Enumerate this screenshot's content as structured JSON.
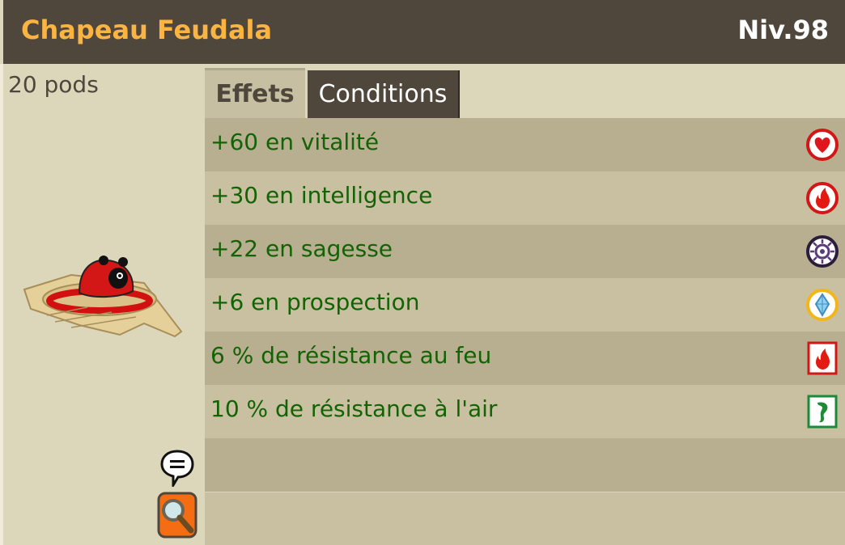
{
  "item": {
    "name": "Chapeau Feudala",
    "level": "Niv.98",
    "weight": "20 pods"
  },
  "tabs": [
    {
      "label": "Effets",
      "active": true
    },
    {
      "label": "Conditions",
      "active": false
    }
  ],
  "effects": [
    {
      "text": "+60 en vitalité",
      "icon": "vitality-heart-icon"
    },
    {
      "text": "+30 en intelligence",
      "icon": "intelligence-fire-icon"
    },
    {
      "text": "+22 en sagesse",
      "icon": "wisdom-eye-icon"
    },
    {
      "text": "+6 en prospection",
      "icon": "prospecting-crystal-icon"
    },
    {
      "text": "6 % de résistance au feu",
      "icon": "fire-resistance-icon"
    },
    {
      "text": "10 % de résistance à l'air",
      "icon": "air-resistance-icon"
    }
  ],
  "colors": {
    "header": "#4f473c",
    "title": "#fbb442",
    "effect_text": "#136305",
    "panel": "#dcd7bb"
  }
}
